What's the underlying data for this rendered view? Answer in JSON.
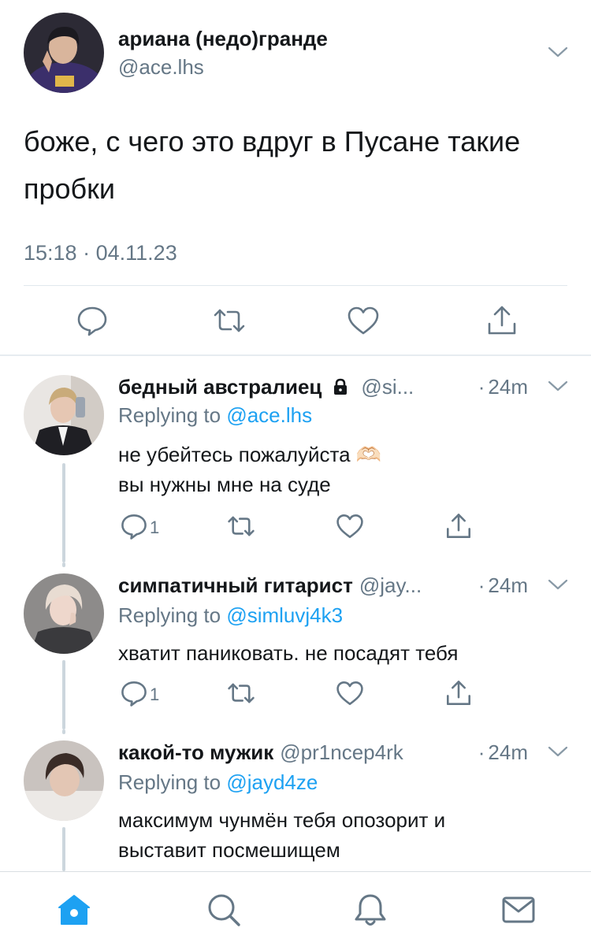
{
  "colors": {
    "accent": "#1da1f2",
    "text": "#14171a",
    "muted": "#657786",
    "icon": "#657786",
    "divider": "#e6ecf0",
    "thread": "#ccd6dd"
  },
  "main_tweet": {
    "author_name": "ариана (недо)гранде",
    "author_handle": "@ace.lhs",
    "text": "боже, с чего это вдруг в Пусане такие пробки",
    "time": "15:18",
    "separator": "·",
    "date": "04.11.23",
    "actions": [
      "reply-icon",
      "retweet-icon",
      "like-icon",
      "share-icon"
    ]
  },
  "replies": [
    {
      "author_name": "бедный австралиец",
      "protected": true,
      "author_handle": "@si...",
      "time": "24m",
      "replying_label": "Replying to",
      "replying_to": "@ace.lhs",
      "text_lines": [
        "не убейтесь пожалуйста 🫶🏻",
        "вы нужны мне на суде"
      ],
      "reply_count": "1"
    },
    {
      "author_name": "симпатичный гитарист",
      "protected": false,
      "author_handle": "@jay...",
      "time": "24m",
      "replying_label": "Replying to",
      "replying_to": "@simluvj4k3",
      "text_lines": [
        "хватит паниковать. не посадят тебя"
      ],
      "reply_count": "1"
    },
    {
      "author_name": "какой-то мужик",
      "protected": false,
      "author_handle": "@pr1ncep4rk",
      "time": "24m",
      "replying_label": "Replying to",
      "replying_to": "@jayd4ze",
      "text_lines": [
        "максимум чунмён тебя опозорит и",
        "выставит посмешищем"
      ],
      "reply_count": ""
    }
  ],
  "tabbar": {
    "tabs": [
      "home-icon",
      "search-icon",
      "notifications-icon",
      "messages-icon"
    ],
    "active": "home-icon"
  }
}
